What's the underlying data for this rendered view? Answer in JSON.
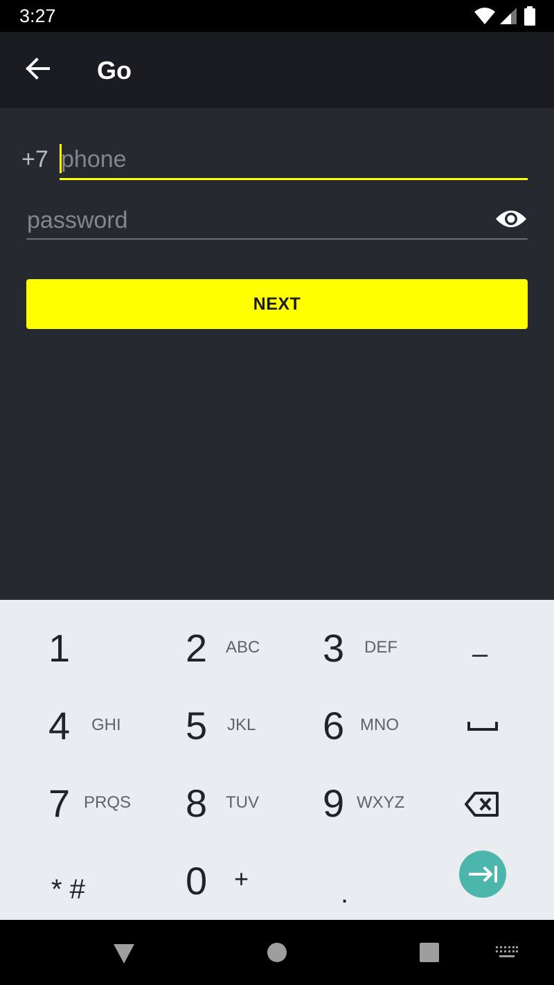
{
  "status_bar": {
    "time": "3:27",
    "icons": [
      "wifi-icon",
      "signal-icon",
      "battery-icon"
    ]
  },
  "app_bar": {
    "back_icon": "arrow-left-icon",
    "title": "Go"
  },
  "form": {
    "phone_prefix": "+7",
    "phone_placeholder": "phone",
    "phone_value": "",
    "password_placeholder": "password",
    "password_value": "",
    "visibility_icon": "eye-icon",
    "next_label": "NEXT"
  },
  "keyboard": {
    "rows": [
      [
        {
          "digit": "1",
          "letters": ""
        },
        {
          "digit": "2",
          "letters": "ABC"
        },
        {
          "digit": "3",
          "letters": "DEF"
        },
        {
          "digit": "–",
          "letters": ""
        }
      ],
      [
        {
          "digit": "4",
          "letters": "GHI"
        },
        {
          "digit": "5",
          "letters": "JKL"
        },
        {
          "digit": "6",
          "letters": "MNO"
        },
        {
          "digit": "",
          "letters": "",
          "icon": "space-icon"
        }
      ],
      [
        {
          "digit": "7",
          "letters": "PRQS"
        },
        {
          "digit": "8",
          "letters": "TUV"
        },
        {
          "digit": "9",
          "letters": "WXYZ"
        },
        {
          "digit": "",
          "letters": "",
          "icon": "backspace-icon"
        }
      ],
      [
        {
          "digit": "* #",
          "letters": ""
        },
        {
          "digit": "0",
          "letters": "+"
        },
        {
          "digit": ".",
          "letters": ""
        },
        {
          "digit": "",
          "letters": "",
          "icon": "next-field-icon"
        }
      ]
    ]
  },
  "nav_bar": {
    "icons": [
      "back-triangle-icon",
      "home-circle-icon",
      "recents-square-icon",
      "keyboard-icon"
    ]
  },
  "colors": {
    "accent": "#ffff00",
    "background": "#262930",
    "app_bar": "#1b1c21",
    "keyboard_bg": "#e9edf0",
    "action_key": "#4db6ac"
  }
}
